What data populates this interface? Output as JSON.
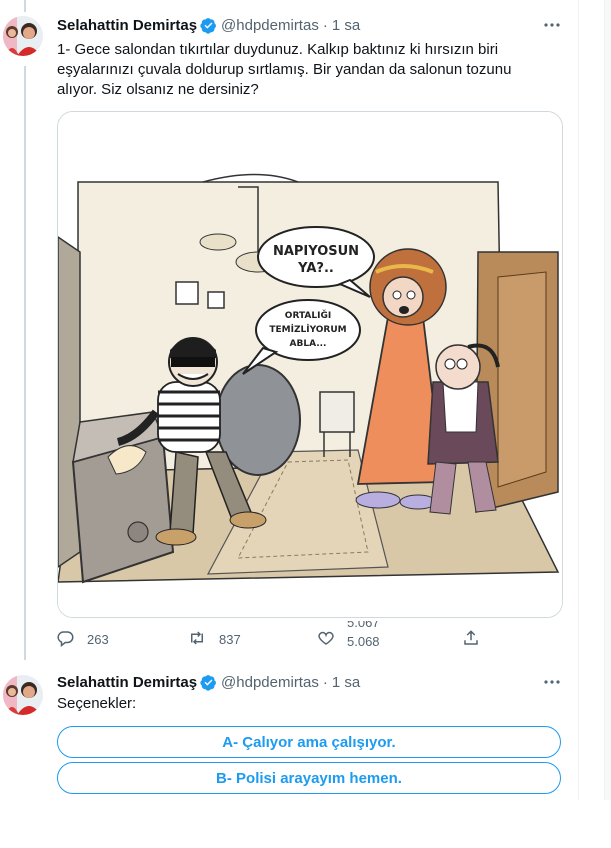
{
  "tweets": [
    {
      "author": {
        "name": "Selahattin Demirtaş",
        "handle": "@hdpdemirtas",
        "time": "1 sa"
      },
      "text": "1- Gece salondan tıkırtılar duydunuz. Kalkıp baktınız ki hırsızın biri eşyalarınızı çuvala doldurup sırtlamış. Bir yandan da salonun tozunu alıyor. Siz olsanız ne dersiniz?",
      "media": {
        "speech_bubbles": [
          "NAPIYOSUN",
          "YA?..",
          "ORTALIĞI",
          "TEMİZLİYORUM",
          "ABLA..."
        ]
      },
      "actions": {
        "replies": "263",
        "retweets": "837",
        "likes_top": "5.067",
        "likes": "5.068"
      }
    },
    {
      "author": {
        "name": "Selahattin Demirtaş",
        "handle": "@hdpdemirtas",
        "time": "1 sa"
      },
      "text": "Seçenekler:",
      "poll": [
        {
          "label": "A- Çalıyor ama çalışıyor."
        },
        {
          "label": "B- Polisi arayayım hemen."
        }
      ]
    }
  ],
  "icons": {
    "verified": "verified-badge-icon",
    "more": "more-icon",
    "reply": "reply-icon",
    "retweet": "retweet-icon",
    "like": "heart-icon",
    "share": "share-icon"
  },
  "colors": {
    "accent": "#1d9bf0",
    "text": "#0f1419",
    "secondary": "#536471",
    "border": "#cfd9de"
  }
}
